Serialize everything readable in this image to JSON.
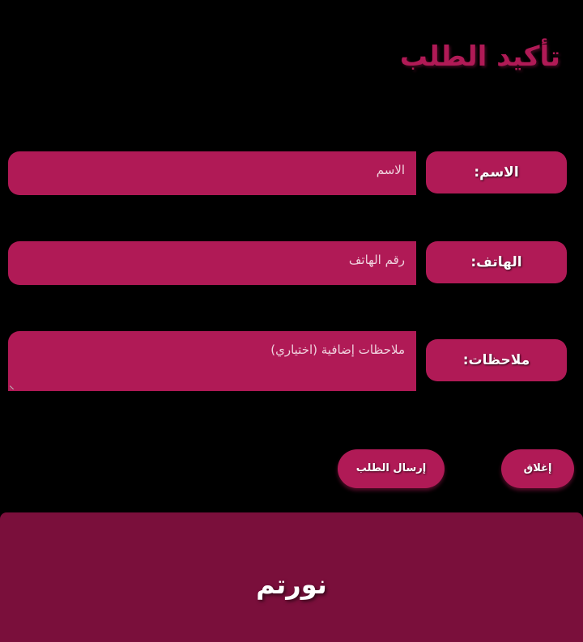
{
  "title": "تأكيد الطلب",
  "form": {
    "name": {
      "label": "الاسم:",
      "placeholder": "الاسم",
      "value": ""
    },
    "phone": {
      "label": "الهاتف:",
      "placeholder": "رقم الهاتف",
      "value": ""
    },
    "notes": {
      "label": "ملاحظات:",
      "placeholder": "ملاحظات إضافية (اختياري)",
      "value": ""
    }
  },
  "buttons": {
    "submit_label": "إرسال الطلب",
    "close_label": "إغلاق"
  },
  "footer": {
    "brand": "نورتم"
  },
  "colors": {
    "accent": "#b01a56",
    "footer": "#7a0f3b",
    "background": "#000000"
  }
}
